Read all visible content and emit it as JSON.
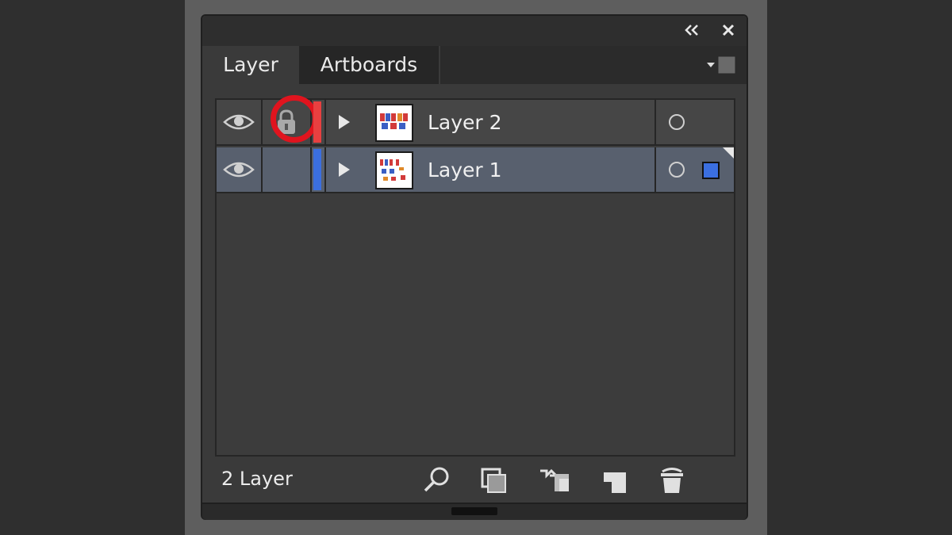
{
  "panel": {
    "collapse_icon": "double-chevron-left-icon",
    "close_icon": "close-icon",
    "tabs": [
      {
        "label": "Layer",
        "active": true
      },
      {
        "label": "Artboards",
        "active": false
      }
    ],
    "menu_icon": "panel-menu-icon"
  },
  "layers": [
    {
      "name": "Layer 2",
      "visible": true,
      "locked": true,
      "color": "#e84040",
      "expand_icon": "triangle-right-icon",
      "selected": false
    },
    {
      "name": "Layer 1",
      "visible": true,
      "locked": false,
      "color": "#3b6fe0",
      "expand_icon": "triangle-right-icon",
      "selected": true
    }
  ],
  "highlight_color": "#e0141e",
  "footer": {
    "count_label": "2 Layer",
    "buttons": [
      {
        "name": "locate-object-button",
        "icon": "search-icon"
      },
      {
        "name": "make-clipping-mask-button",
        "icon": "clipping-mask-icon"
      },
      {
        "name": "create-sublayer-button",
        "icon": "sublayer-icon"
      },
      {
        "name": "create-new-layer-button",
        "icon": "new-layer-icon"
      },
      {
        "name": "delete-layer-button",
        "icon": "trash-icon"
      }
    ]
  }
}
